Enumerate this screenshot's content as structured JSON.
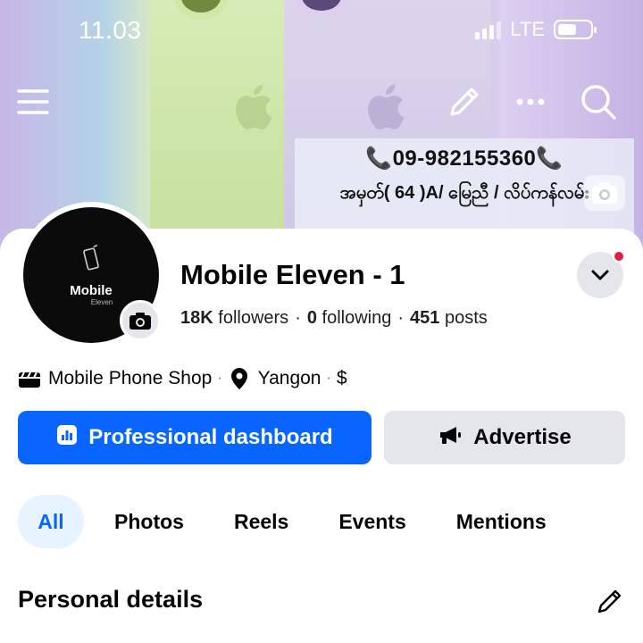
{
  "status": {
    "time": "11.03",
    "network": "LTE"
  },
  "cover": {
    "promo_phone": "📞09-982155360📞",
    "promo_address": "အမှတ်( 64 )A/ မြေညီ / လိပ်ကန်လမ်း"
  },
  "avatar": {
    "brand": "Mobile",
    "sub": "Eleven"
  },
  "profile": {
    "name": "Mobile Eleven - 1",
    "followers_count": "18K",
    "followers_label": "followers",
    "following_count": "0",
    "following_label": "following",
    "posts_count": "451",
    "posts_label": "posts",
    "category": "Mobile Phone Shop",
    "location": "Yangon",
    "price_range": "$"
  },
  "actions": {
    "primary_label": "Professional dashboard",
    "secondary_label": "Advertise"
  },
  "tabs": [
    {
      "label": "All",
      "active": true
    },
    {
      "label": "Photos",
      "active": false
    },
    {
      "label": "Reels",
      "active": false
    },
    {
      "label": "Events",
      "active": false
    },
    {
      "label": "Mentions",
      "active": false
    }
  ],
  "section": {
    "title": "Personal details"
  },
  "icons": {
    "menu": "menu-icon",
    "edit": "pencil-icon",
    "more": "more-icon",
    "search": "search-icon",
    "camera": "camera-icon",
    "chevron": "chevron-down-icon",
    "category": "clapperboard-icon",
    "location": "location-pin-icon",
    "dashboard": "bar-chart-icon",
    "advertise": "megaphone-icon"
  },
  "colors": {
    "primary": "#0866ff",
    "secondary_bg": "#e4e6eb",
    "tab_active_bg": "#e7f3ff",
    "notification": "#e41e3f"
  }
}
